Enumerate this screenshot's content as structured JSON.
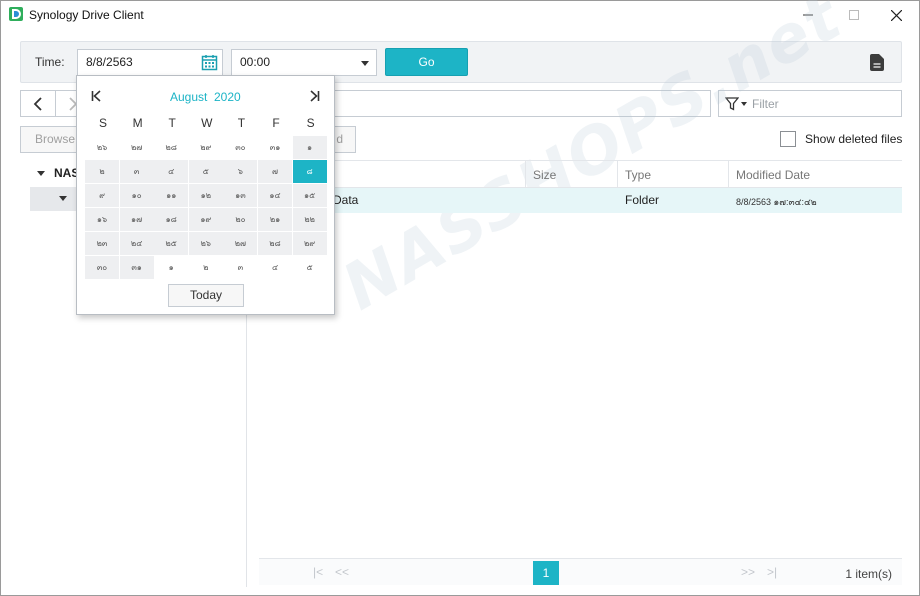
{
  "window": {
    "title": "Synology Drive Client"
  },
  "toolbar": {
    "time_label": "Time:",
    "date_value": "8/8/2563",
    "time_value": "00:00",
    "go_label": "Go"
  },
  "nav": {
    "browse_label": "Browse",
    "restore_label": "d",
    "filter_placeholder": "Filter",
    "show_deleted_label": "Show deleted files"
  },
  "tree": {
    "root_label": "NAS"
  },
  "table": {
    "columns": [
      "Size",
      "Type",
      "Modified Date"
    ],
    "rows": [
      {
        "name": "Data",
        "size": "",
        "type": "Folder",
        "modified": "8/8/2563 ๑๗:๓๔:๔๒"
      }
    ]
  },
  "pager": {
    "current_page": "1",
    "count_label": "1 item(s)"
  },
  "watermark": "NASSHOPS.net",
  "calendar": {
    "month": "August",
    "year": "2020",
    "weekdays": [
      "S",
      "M",
      "T",
      "W",
      "T",
      "F",
      "S"
    ],
    "weeks": [
      [
        "๒๖",
        "๒๗",
        "๒๘",
        "๒๙",
        "๓๐",
        "๓๑",
        "๑"
      ],
      [
        "๒",
        "๓",
        "๔",
        "๕",
        "๖",
        "๗",
        "๘"
      ],
      [
        "๙",
        "๑๐",
        "๑๑",
        "๑๒",
        "๑๓",
        "๑๔",
        "๑๕"
      ],
      [
        "๑๖",
        "๑๗",
        "๑๘",
        "๑๙",
        "๒๐",
        "๒๑",
        "๒๒"
      ],
      [
        "๒๓",
        "๒๔",
        "๒๕",
        "๒๖",
        "๒๗",
        "๒๘",
        "๒๙"
      ],
      [
        "๓๐",
        "๓๑",
        "๑",
        "๒",
        "๓",
        "๔",
        "๕"
      ]
    ],
    "selected": "๘",
    "today_label": "Today"
  },
  "colors": {
    "accent": "#1db4c6",
    "row_highlight": "#e6f6f8"
  }
}
